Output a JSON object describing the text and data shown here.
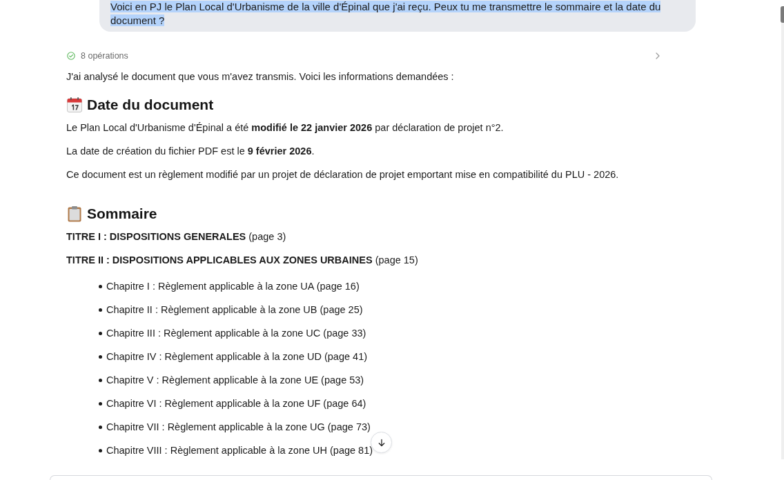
{
  "user_message": {
    "text": "Voici en PJ le Plan Local d'Urbanisme de la ville d'Épinal que j'ai reçu. Peux tu me transmettre le sommaire et la date du document ?",
    "text_selected": true
  },
  "operations": {
    "label": "8 opérations",
    "expanded": false
  },
  "intro": "J'ai analysé le document que vous m'avez transmis. Voici les informations demandées :",
  "sections": [
    {
      "heading": "Date du document",
      "blocks": [
        {
          "kind": "paragraph",
          "text": "Le Plan Local d'Urbanisme d'Épinal a été **modifié le 22 janvier 2026** par déclaration de projet n°2."
        },
        {
          "kind": "paragraph",
          "text": "La date de création du fichier PDF est le **9 février 2026**."
        },
        {
          "kind": "paragraph",
          "text": "Ce document est un règlement modifié par un projet de déclaration de projet emportant mise en compatibilité du PLU - 2026."
        }
      ]
    },
    {
      "heading": "Sommaire",
      "blocks": [
        {
          "kind": "paragraph",
          "text": "**TITRE I : DISPOSITIONS GENERALES** (page 3)"
        },
        {
          "kind": "paragraph",
          "text": "**TITRE II : DISPOSITIONS APPLICABLES AUX ZONES URBAINES** (page 15)"
        },
        {
          "kind": "list",
          "items": [
            "Chapitre I : Règlement applicable à la zone UA (page 16)",
            "Chapitre II : Règlement applicable à la zone UB (page 25)",
            "Chapitre III : Règlement applicable à la zone UC (page 33)",
            "Chapitre IV : Règlement applicable à la zone UD (page 41)",
            "Chapitre V : Règlement applicable à la zone UE (page 53)",
            "Chapitre VI : Règlement applicable à la zone UF (page 64)",
            "Chapitre VII : Règlement applicable à la zone UG (page 73)",
            "Chapitre VIII : Règlement applicable à la zone UH (page 81)"
          ]
        }
      ]
    }
  ]
}
